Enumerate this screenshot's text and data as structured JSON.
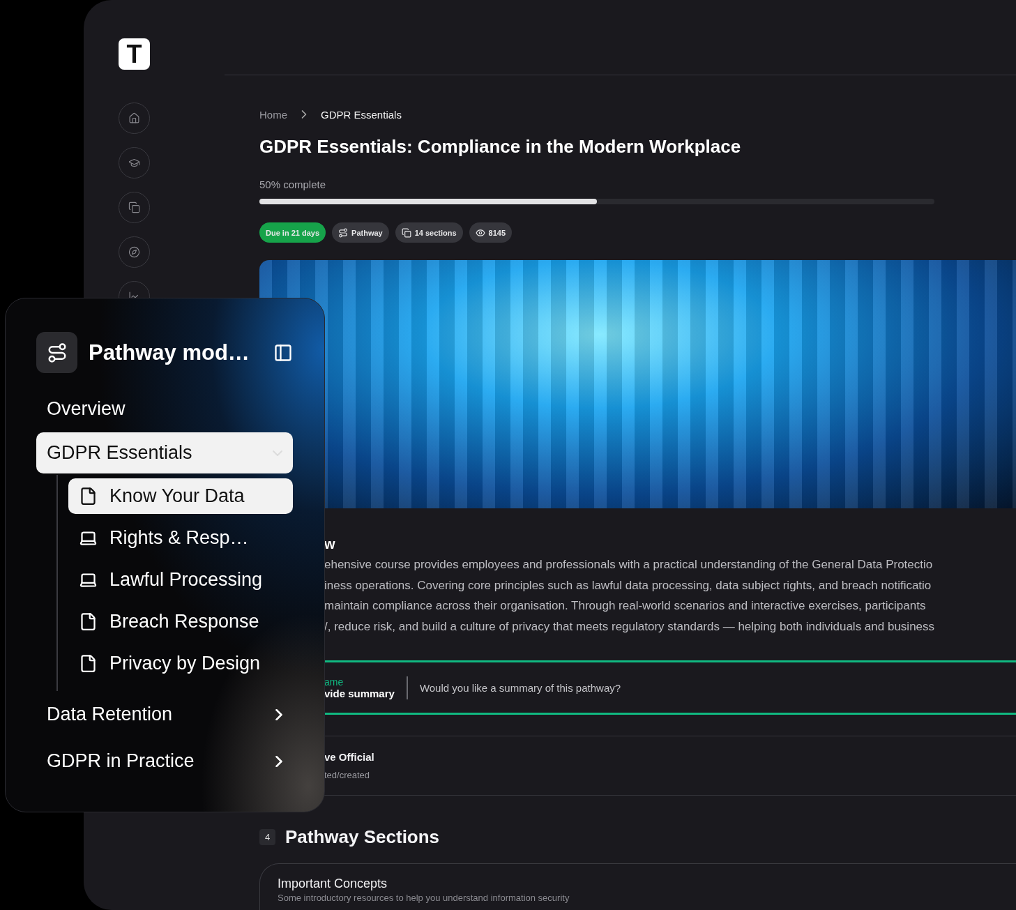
{
  "app": {
    "logo": "T"
  },
  "breadcrumb": [
    "Home",
    "GDPR Essentials"
  ],
  "title": "GDPR Essentials: Compliance in the Modern Workplace",
  "progress": {
    "label": "50% complete",
    "level": 0.5
  },
  "badges": [
    {
      "kind": "due",
      "label": "Due in 21 days"
    },
    {
      "kind": "type",
      "label": "Pathway"
    },
    {
      "kind": "sections",
      "label": "14 sections"
    },
    {
      "kind": "views",
      "label": "8145"
    }
  ],
  "overview": {
    "heading": "w",
    "lines": [
      "ehensive course provides employees and professionals with a practical understanding of the General Data Protectio",
      "iness operations. Covering core principles such as lawful data processing, data subject rights, and breach notificatio",
      "maintain compliance across their organisation. Through real-world scenarios and interactive exercises, participants",
      "/, reduce risk, and build a culture of privacy that meets regulatory standards — helping both individuals and business"
    ]
  },
  "summary": {
    "label": "ame",
    "action": "vide summary",
    "prompt": "Would you like a summary of this pathway?"
  },
  "official": {
    "title": "ve Official",
    "subtitle": "ted/created"
  },
  "sections": {
    "count": "4",
    "heading": "Pathway Sections",
    "cards": [
      {
        "title": "Important Concepts",
        "description": "Some introductory resources to help you understand information security"
      }
    ]
  },
  "panel": {
    "title": "Pathway mod…",
    "items": [
      {
        "label": "Overview",
        "kind": "link",
        "selected": false
      },
      {
        "label": "GDPR Essentials",
        "kind": "group",
        "selected": true,
        "expanded": true,
        "children": [
          {
            "label": "Know Your Data",
            "kind": "document",
            "selected": true
          },
          {
            "label": "Rights & Resp…",
            "kind": "laptop",
            "selected": false
          },
          {
            "label": "Lawful Processing",
            "kind": "laptop",
            "selected": false
          },
          {
            "label": "Breach Response",
            "kind": "document",
            "selected": false
          },
          {
            "label": "Privacy by Design",
            "kind": "document",
            "selected": false
          }
        ]
      },
      {
        "label": "Data Retention",
        "kind": "group",
        "selected": false,
        "expanded": false
      },
      {
        "label": "GDPR in Practice",
        "kind": "group",
        "selected": false,
        "expanded": false
      }
    ]
  }
}
